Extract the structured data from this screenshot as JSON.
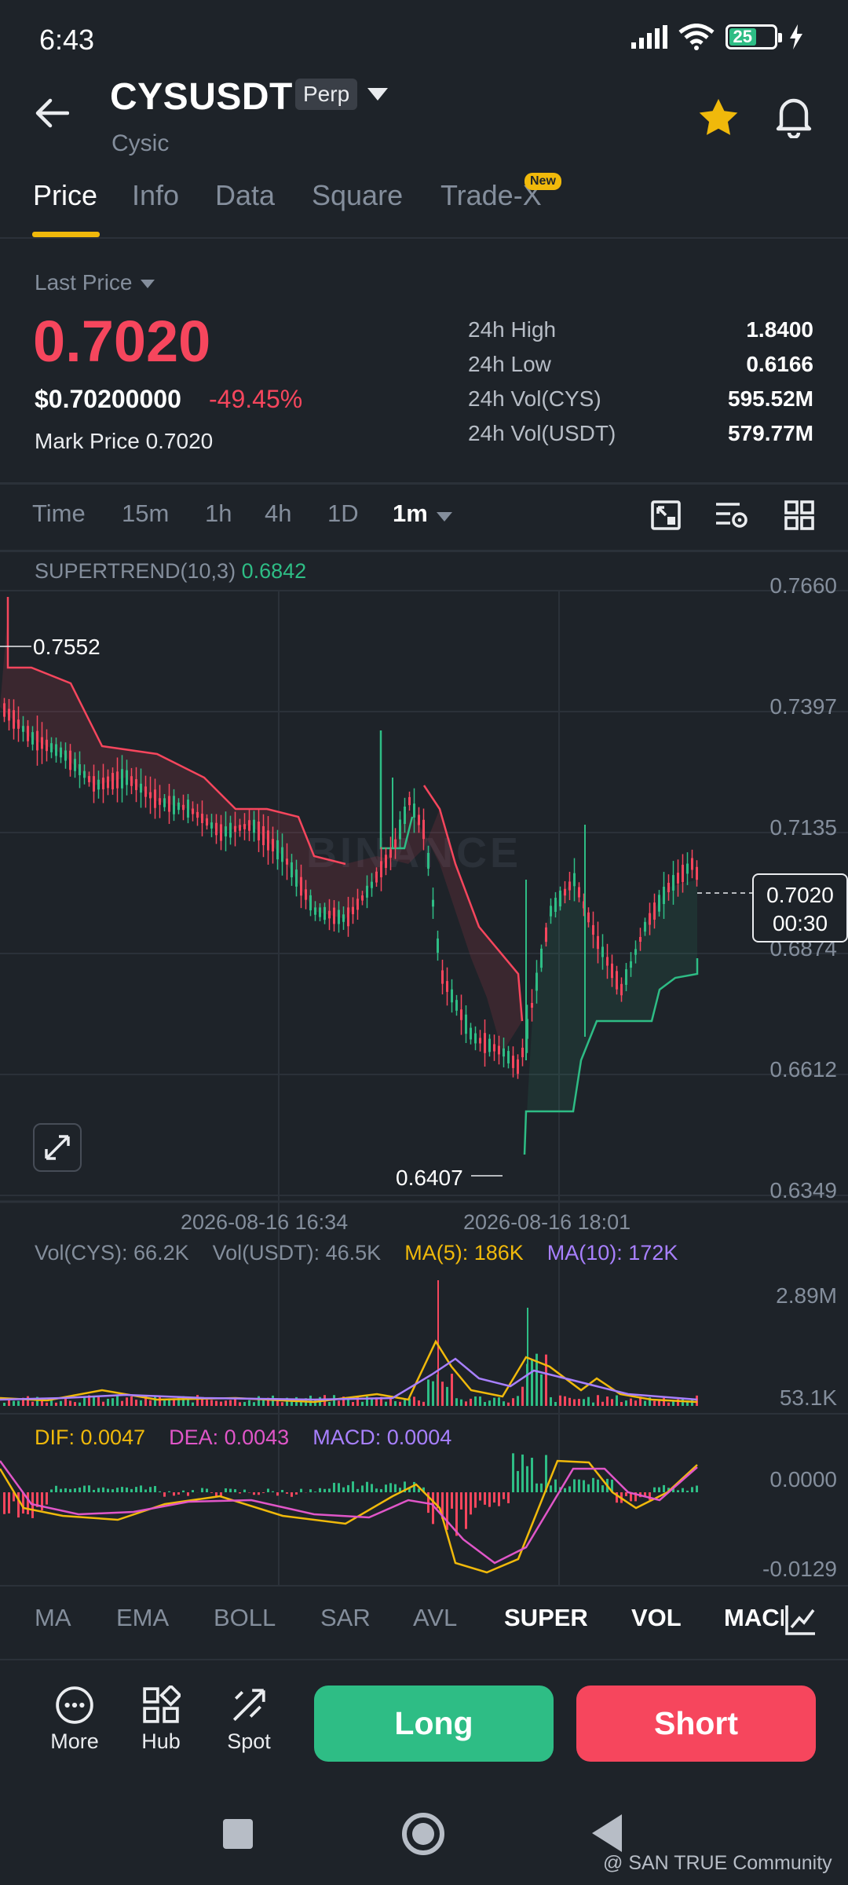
{
  "status": {
    "time": "6:43",
    "battery": "25"
  },
  "header": {
    "symbol": "CYSUSDT",
    "contract": "Perp",
    "name": "Cysic"
  },
  "tabs": [
    {
      "label": "Price",
      "active": true
    },
    {
      "label": "Info"
    },
    {
      "label": "Data"
    },
    {
      "label": "Square"
    },
    {
      "label": "Trade-X",
      "badge": "New"
    }
  ],
  "price": {
    "label": "Last Price",
    "last": "0.7020",
    "usd": "$0.70200000",
    "change": "-49.45%",
    "mark_label": "Mark Price",
    "mark": "0.7020"
  },
  "stats": [
    {
      "label": "24h High",
      "value": "1.8400"
    },
    {
      "label": "24h Low",
      "value": "0.6166"
    },
    {
      "label": "24h Vol(CYS)",
      "value": "595.52M"
    },
    {
      "label": "24h Vol(USDT)",
      "value": "579.77M"
    }
  ],
  "intervals": [
    "Time",
    "15m",
    "1h",
    "4h",
    "1D",
    "1m"
  ],
  "active_interval": "1m",
  "chart": {
    "indicator": "SUPERTREND(10,3)",
    "indicator_value": "0.6842",
    "axis": [
      "0.7660",
      "0.7397",
      "0.7135",
      "0.6874",
      "0.6612",
      "0.6349"
    ],
    "current_price": "0.7020",
    "countdown": "00:30",
    "high_label": "0.7552",
    "low_label": "0.6407",
    "dates": [
      "2026-08-16 16:34",
      "2026-08-16 18:01"
    ],
    "watermark": "BINANCE",
    "colors": {
      "up": "#2ebd85",
      "down": "#f6465d",
      "accent": "#f0b90b"
    }
  },
  "volume": {
    "vol_cys": "Vol(CYS): 66.2K",
    "vol_usdt": "Vol(USDT): 46.5K",
    "ma5": "MA(5): 186K",
    "ma10": "MA(10): 172K",
    "axis_top": "2.89M",
    "axis_bottom": "53.1K"
  },
  "macd": {
    "dif": "DIF: 0.0047",
    "dea": "DEA: 0.0043",
    "macd": "MACD: 0.0004",
    "axis_top": "0.0000",
    "axis_bottom": "-0.0129"
  },
  "indicator_tabs": [
    "MA",
    "EMA",
    "BOLL",
    "SAR",
    "AVL",
    "SUPER",
    "VOL",
    "MACD"
  ],
  "bottom": {
    "more": "More",
    "hub": "Hub",
    "spot": "Spot",
    "long": "Long",
    "short": "Short"
  },
  "credit": "@ SAN TRUE Community"
}
